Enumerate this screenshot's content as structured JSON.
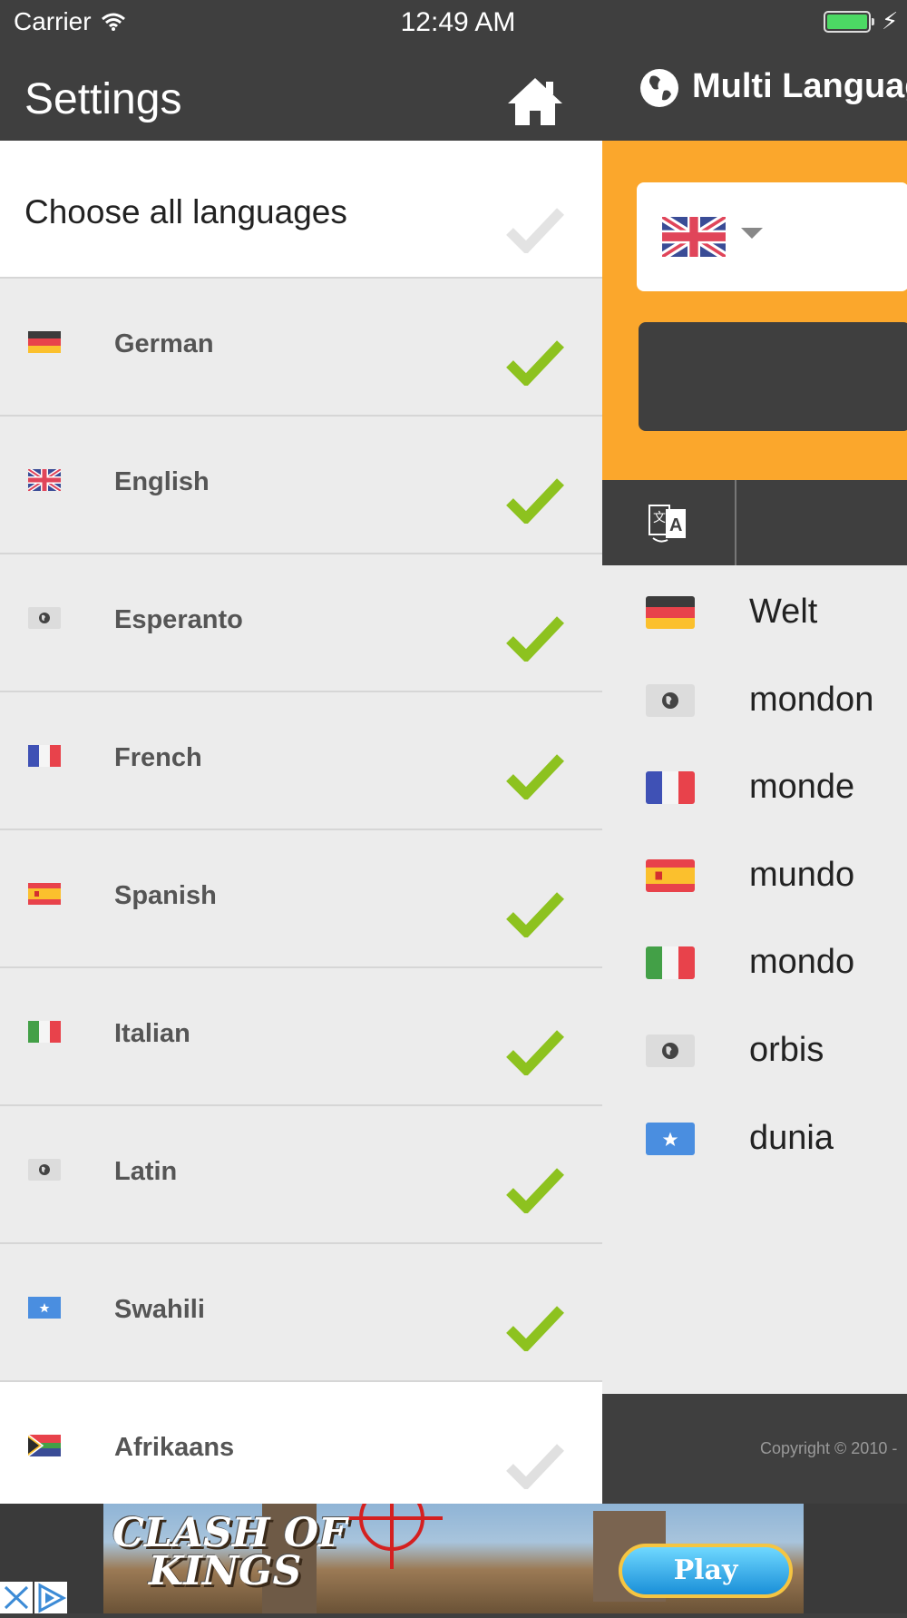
{
  "status_bar": {
    "carrier": "Carrier",
    "time": "12:49 AM"
  },
  "settings": {
    "title": "Settings",
    "choose_all_label": "Choose all languages",
    "languages": [
      {
        "label": "German",
        "flag": "de",
        "checked": true
      },
      {
        "label": "English",
        "flag": "gb",
        "checked": true
      },
      {
        "label": "Esperanto",
        "flag": "globe",
        "checked": true
      },
      {
        "label": "French",
        "flag": "fr",
        "checked": true
      },
      {
        "label": "Spanish",
        "flag": "es",
        "checked": true
      },
      {
        "label": "Italian",
        "flag": "it",
        "checked": true
      },
      {
        "label": "Latin",
        "flag": "globe",
        "checked": true
      },
      {
        "label": "Swahili",
        "flag": "so",
        "checked": true
      },
      {
        "label": "Afrikaans",
        "flag": "za",
        "checked": false
      }
    ]
  },
  "main": {
    "brand": "Multi Languag",
    "source_flag": "gb",
    "results": [
      {
        "word": "Welt",
        "flag": "de"
      },
      {
        "word": "mondon",
        "flag": "globe"
      },
      {
        "word": "monde",
        "flag": "fr"
      },
      {
        "word": "mundo",
        "flag": "es"
      },
      {
        "word": "mondo",
        "flag": "it"
      },
      {
        "word": "orbis",
        "flag": "globe"
      },
      {
        "word": "dunia",
        "flag": "so"
      }
    ],
    "copyright": "Copyright © 2010 -"
  },
  "ad": {
    "title_line1": "CLASH OF",
    "title_line2": "KINGS",
    "play_label": "Play"
  },
  "colors": {
    "accent_orange": "#fba72c",
    "check_green": "#8dc21f",
    "check_grey": "#e0e0e0",
    "header_dark": "#3f3f3f"
  }
}
